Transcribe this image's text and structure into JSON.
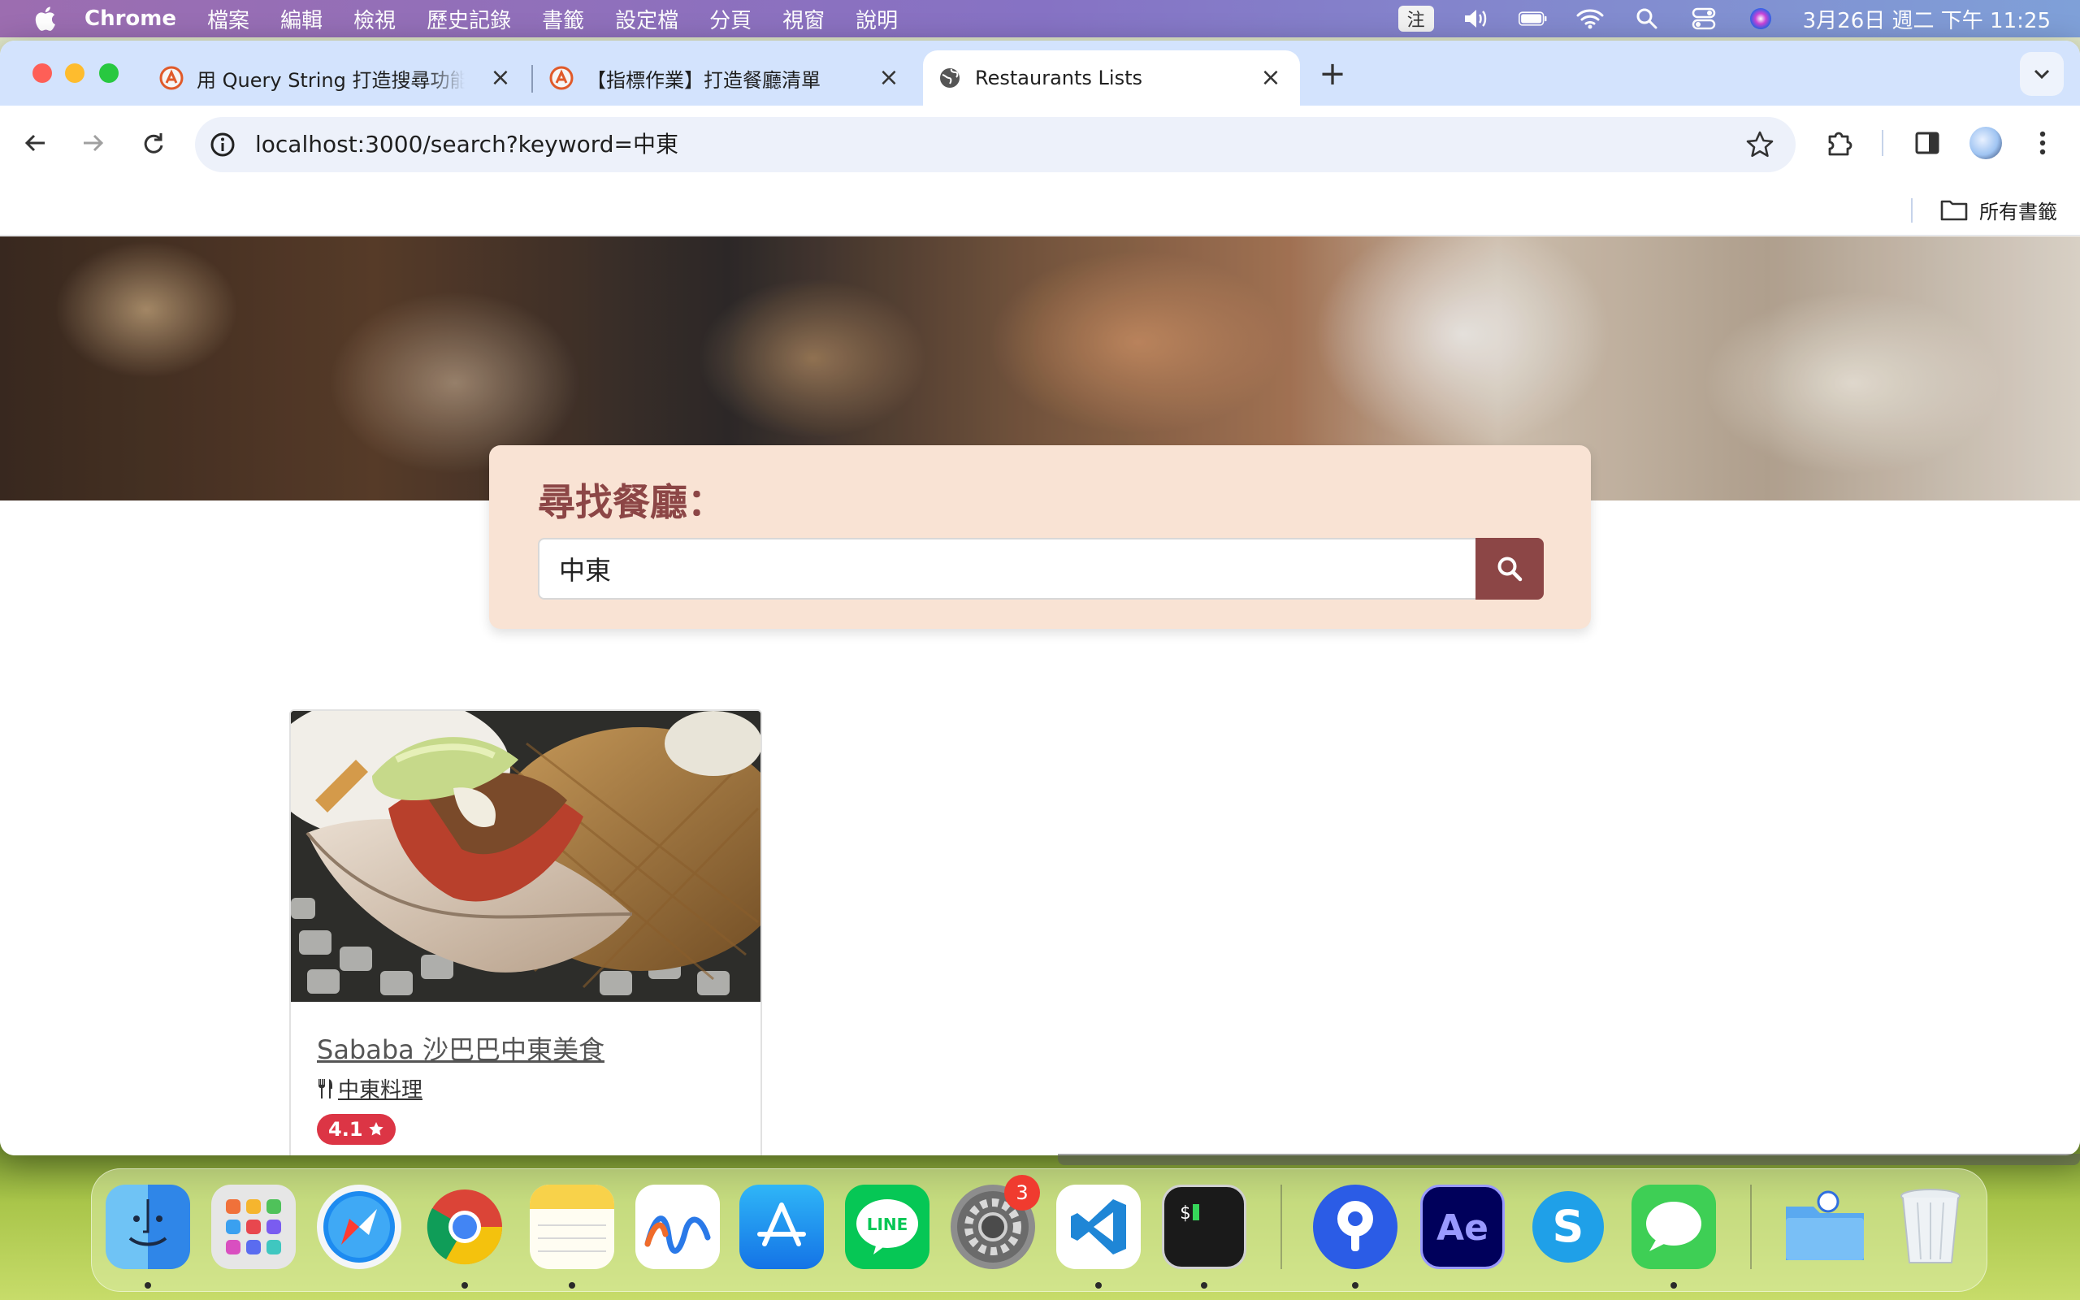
{
  "menubar": {
    "app_name": "Chrome",
    "menus": [
      "檔案",
      "編輯",
      "檢視",
      "歷史記錄",
      "書籤",
      "設定檔",
      "分頁",
      "視窗",
      "說明"
    ],
    "ime": "注",
    "clock": "3月26日 週二 下午 11:25"
  },
  "browser": {
    "tabs": [
      {
        "title": "用 Query String 打造搜尋功能",
        "icon": "alpha-camp-favicon"
      },
      {
        "title": "【指標作業】打造餐廳清單",
        "icon": "alpha-camp-favicon"
      },
      {
        "title": "Restaurants Lists",
        "icon": "globe-icon",
        "active": true
      }
    ],
    "url": "localhost:3000/search?keyword=中東",
    "bookmarks_folder": "所有書籤"
  },
  "page": {
    "search": {
      "title": "尋找餐廳：",
      "value": "中東"
    },
    "restaurants": [
      {
        "name": "Sababa 沙巴巴中東美食",
        "category": "中東料理",
        "rating": "4.1"
      }
    ]
  },
  "dock": {
    "apps": [
      "Finder",
      "Launchpad",
      "Safari",
      "Chrome",
      "Notes",
      "Freeform",
      "App Store",
      "LINE",
      "System Settings",
      "Visual Studio Code",
      "Terminal",
      "Proton Pass",
      "After Effects",
      "Skype",
      "Messages",
      "Folder",
      "Trash"
    ],
    "settings_badge": "3"
  },
  "colors": {
    "accent": "#8c4646",
    "panel_bg": "#f9e3d4",
    "badge_red": "#dc3545"
  }
}
